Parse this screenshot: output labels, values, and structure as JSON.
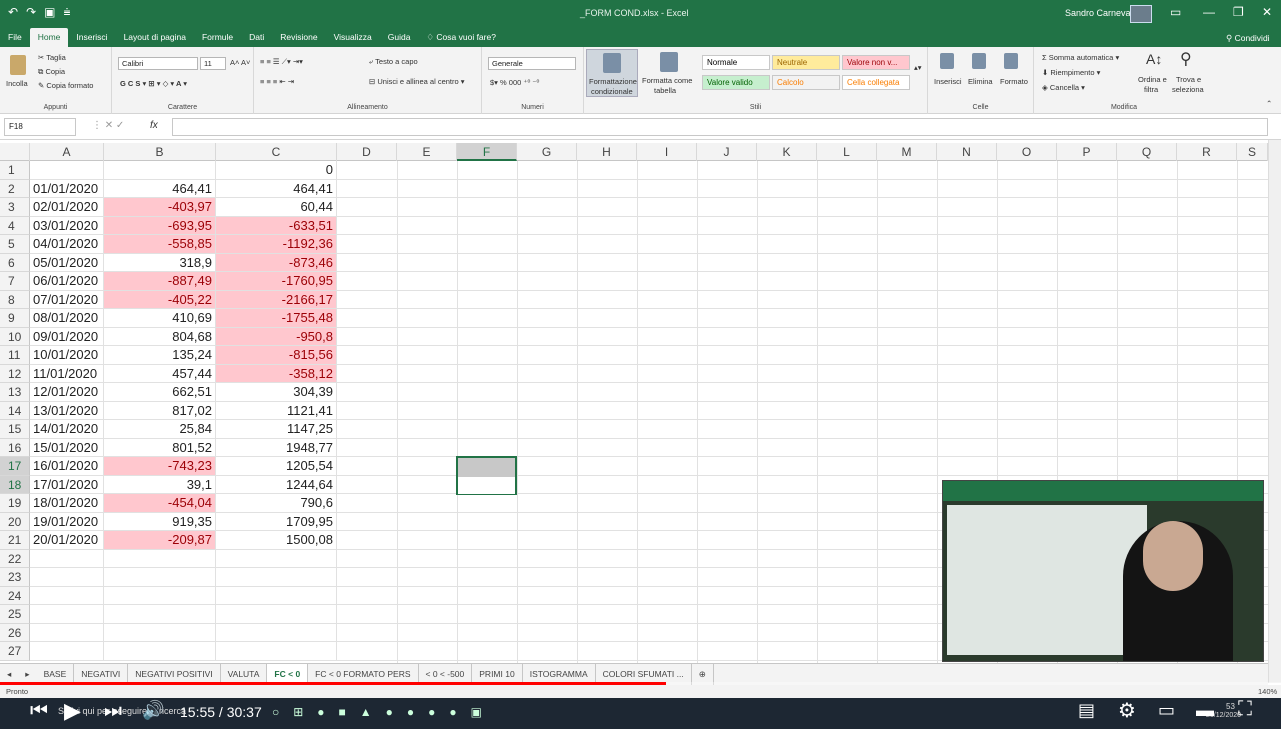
{
  "window": {
    "title": "_FORM COND.xlsx - Excel",
    "user": "Sandro Carnevali"
  },
  "menu": [
    "File",
    "Home",
    "Inserisci",
    "Layout di pagina",
    "Formule",
    "Dati",
    "Revisione",
    "Visualizza",
    "Guida",
    "Cosa vuoi fare?"
  ],
  "share_label": "Condividi",
  "ribbon": {
    "clipboard": {
      "paste": "Incolla",
      "cut": "Taglia",
      "copy": "Copia",
      "format_painter": "Copia formato",
      "label": "Appunti"
    },
    "font": {
      "name": "Calibri",
      "size": "11",
      "label": "Carattere"
    },
    "alignment": {
      "wrap": "Testo a capo",
      "merge": "Unisci e allinea al centro",
      "label": "Allineamento"
    },
    "number": {
      "format": "Generale",
      "label": "Numeri"
    },
    "styles": {
      "cond_format_1": "Formattazione",
      "cond_format_2": "condizionale",
      "format_table_1": "Formatta come",
      "format_table_2": "tabella",
      "label": "Stili",
      "cells": [
        {
          "text": "Normale",
          "bg": "#ffffff",
          "fg": "#000000"
        },
        {
          "text": "Neutrale",
          "bg": "#ffeb9c",
          "fg": "#9c6500"
        },
        {
          "text": "Valore non v...",
          "bg": "#ffc7ce",
          "fg": "#9c0006"
        },
        {
          "text": "Valore valido",
          "bg": "#c6efce",
          "fg": "#006100"
        },
        {
          "text": "Calcolo",
          "bg": "#f2f2f2",
          "fg": "#fa7d00"
        },
        {
          "text": "Cella collegata",
          "bg": "#ffffff",
          "fg": "#fa7d00"
        }
      ]
    },
    "cells_group": {
      "insert": "Inserisci",
      "delete": "Elimina",
      "format": "Formato",
      "label": "Celle"
    },
    "editing": {
      "autosum": "Somma automatica",
      "fill": "Riempimento",
      "clear": "Cancella",
      "sort": "Ordina e",
      "sort2": "filtra",
      "find": "Trova e",
      "find2": "seleziona",
      "label": "Modifica"
    }
  },
  "formula_bar": {
    "name_box": "F18",
    "fx": "fx",
    "value": ""
  },
  "columns": [
    "A",
    "B",
    "C",
    "D",
    "E",
    "F",
    "G",
    "H",
    "I",
    "J",
    "K",
    "L",
    "M",
    "N",
    "O",
    "P",
    "Q",
    "R",
    "S"
  ],
  "rows": [
    {
      "n": "1",
      "a": "",
      "b": "",
      "c": "0",
      "bneg": false,
      "cneg": false
    },
    {
      "n": "2",
      "a": "01/01/2020",
      "b": "464,41",
      "c": "464,41",
      "bneg": false,
      "cneg": false
    },
    {
      "n": "3",
      "a": "02/01/2020",
      "b": "-403,97",
      "c": "60,44",
      "bneg": true,
      "cneg": false
    },
    {
      "n": "4",
      "a": "03/01/2020",
      "b": "-693,95",
      "c": "-633,51",
      "bneg": true,
      "cneg": true
    },
    {
      "n": "5",
      "a": "04/01/2020",
      "b": "-558,85",
      "c": "-1192,36",
      "bneg": true,
      "cneg": true
    },
    {
      "n": "6",
      "a": "05/01/2020",
      "b": "318,9",
      "c": "-873,46",
      "bneg": false,
      "cneg": true
    },
    {
      "n": "7",
      "a": "06/01/2020",
      "b": "-887,49",
      "c": "-1760,95",
      "bneg": true,
      "cneg": true
    },
    {
      "n": "8",
      "a": "07/01/2020",
      "b": "-405,22",
      "c": "-2166,17",
      "bneg": true,
      "cneg": true
    },
    {
      "n": "9",
      "a": "08/01/2020",
      "b": "410,69",
      "c": "-1755,48",
      "bneg": false,
      "cneg": true
    },
    {
      "n": "10",
      "a": "09/01/2020",
      "b": "804,68",
      "c": "-950,8",
      "bneg": false,
      "cneg": true
    },
    {
      "n": "11",
      "a": "10/01/2020",
      "b": "135,24",
      "c": "-815,56",
      "bneg": false,
      "cneg": true
    },
    {
      "n": "12",
      "a": "11/01/2020",
      "b": "457,44",
      "c": "-358,12",
      "bneg": false,
      "cneg": true
    },
    {
      "n": "13",
      "a": "12/01/2020",
      "b": "662,51",
      "c": "304,39",
      "bneg": false,
      "cneg": false
    },
    {
      "n": "14",
      "a": "13/01/2020",
      "b": "817,02",
      "c": "1121,41",
      "bneg": false,
      "cneg": false
    },
    {
      "n": "15",
      "a": "14/01/2020",
      "b": "25,84",
      "c": "1147,25",
      "bneg": false,
      "cneg": false
    },
    {
      "n": "16",
      "a": "15/01/2020",
      "b": "801,52",
      "c": "1948,77",
      "bneg": false,
      "cneg": false
    },
    {
      "n": "17",
      "a": "16/01/2020",
      "b": "-743,23",
      "c": "1205,54",
      "bneg": true,
      "cneg": false
    },
    {
      "n": "18",
      "a": "17/01/2020",
      "b": "39,1",
      "c": "1244,64",
      "bneg": false,
      "cneg": false
    },
    {
      "n": "19",
      "a": "18/01/2020",
      "b": "-454,04",
      "c": "790,6",
      "bneg": true,
      "cneg": false
    },
    {
      "n": "20",
      "a": "19/01/2020",
      "b": "919,35",
      "c": "1709,95",
      "bneg": false,
      "cneg": false
    },
    {
      "n": "21",
      "a": "20/01/2020",
      "b": "-209,87",
      "c": "1500,08",
      "bneg": true,
      "cneg": false
    },
    {
      "n": "22",
      "a": "",
      "b": "",
      "c": "",
      "bneg": false,
      "cneg": false
    },
    {
      "n": "23",
      "a": "",
      "b": "",
      "c": "",
      "bneg": false,
      "cneg": false
    },
    {
      "n": "24",
      "a": "",
      "b": "",
      "c": "",
      "bneg": false,
      "cneg": false
    },
    {
      "n": "25",
      "a": "",
      "b": "",
      "c": "",
      "bneg": false,
      "cneg": false
    },
    {
      "n": "26",
      "a": "",
      "b": "",
      "c": "",
      "bneg": false,
      "cneg": false
    },
    {
      "n": "27",
      "a": "",
      "b": "",
      "c": "",
      "bneg": false,
      "cneg": false
    }
  ],
  "sheet_tabs": [
    "BASE",
    "NEGATIVI",
    "NEGATIVI POSITIVI",
    "VALUTA",
    "FC < 0",
    "FC < 0 FORMATO PERS",
    "< 0 < -500",
    "PRIMI 10",
    "ISTOGRAMMA",
    "COLORI SFUMATI ..."
  ],
  "active_tab": "FC < 0",
  "status": {
    "ready": "Pronto",
    "zoom": "140%"
  },
  "video": {
    "time": "15:55 / 30:37",
    "progress": 0.52
  },
  "taskbar": {
    "search": "Scrivi qui per eseguire la ricerca",
    "clock_time": "53",
    "clock_date": "20/12/2020"
  }
}
